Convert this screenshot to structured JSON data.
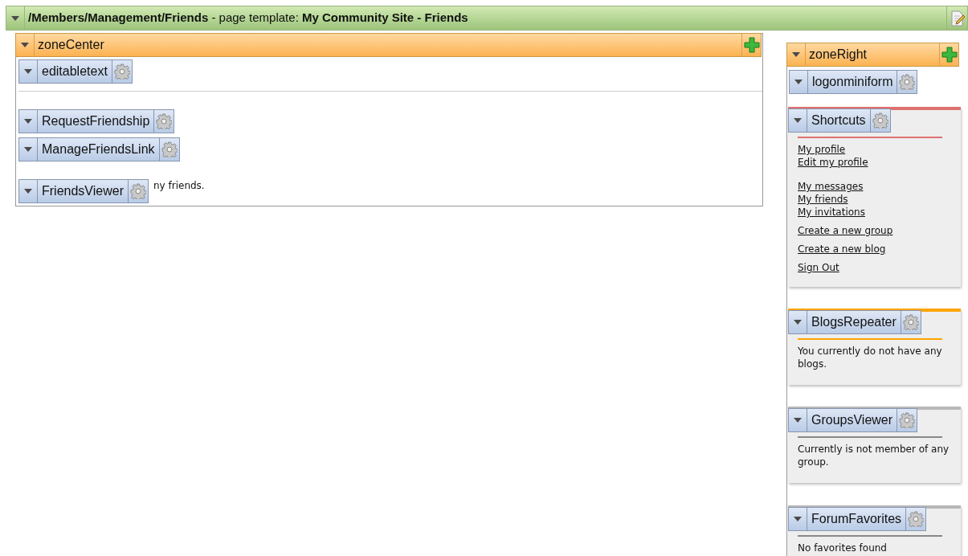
{
  "top_bar": {
    "title": "**/Members/Management/Friends** - page template: **My Community Site - Friends**"
  },
  "zone_center": {
    "name": "zoneCenter",
    "webparts": [
      {
        "name": "editabletext"
      },
      {
        "name": "RequestFriendship"
      },
      {
        "name": "ManageFriendsLink"
      },
      {
        "name": "FriendsViewer"
      }
    ],
    "visible_text": "ny friends."
  },
  "zone_right": {
    "name": "zoneRight",
    "webparts": [
      {
        "kind": "handle",
        "name": "logonminiform"
      },
      {
        "kind": "panel",
        "name": "Shortcuts",
        "color": "#e07070",
        "link_groups": [
          [
            "My profile",
            "Edit my profile"
          ],
          [
            "My messages",
            "My friends",
            "My invitations"
          ],
          [
            "Create a new group"
          ],
          [
            "Create a new blog"
          ],
          [
            "Sign Out"
          ]
        ]
      },
      {
        "kind": "panel",
        "name": "BlogsRepeater",
        "color": "#ffa500",
        "text": "You currently do not have any blogs."
      },
      {
        "kind": "panel",
        "name": "GroupsViewer",
        "color": "#b8b8b8",
        "text": "Currently is not member of any group."
      },
      {
        "kind": "panel",
        "name": "ForumFavorites",
        "color": "#b8b8b8",
        "text": "No favorites found"
      }
    ]
  }
}
